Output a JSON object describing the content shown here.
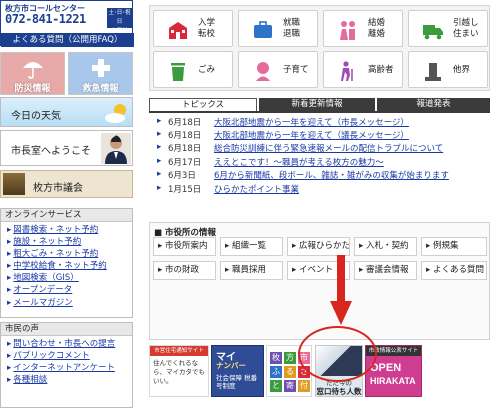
{
  "callcenter": {
    "label": "枚方市コールセンター",
    "number": "072-841-1221",
    "badge_line1": "土･日･祝日",
    "badge_line2": "も受付",
    "faq": "よくある質問（公開用FAQ）"
  },
  "left_tiles": {
    "bosai": "防災情報",
    "kyukyu": "救急情報",
    "weather": "今日の天気",
    "mayor": "市長室へようこそ",
    "council": "枚方市議会"
  },
  "online_services": {
    "heading": "オンラインサービス",
    "items": [
      "図書検索・ネット予約",
      "施設・ネット予約",
      "粗大ごみ・ネット予約",
      "中学校給食・ネット予約",
      "地図検索（GIS）",
      "オープンデータ",
      "メールマガジン"
    ]
  },
  "citizen_voice": {
    "heading": "市民の声",
    "items": [
      "問い合わせ・市長への提言",
      "パブリックコメント",
      "インターネットアンケート",
      "各種相談"
    ]
  },
  "categories": [
    {
      "label": "入学\n転校",
      "icon": "school-icon",
      "color": "#d8293a"
    },
    {
      "label": "就職\n退職",
      "icon": "briefcase-icon",
      "color": "#2f73c8"
    },
    {
      "label": "結婚\n離婚",
      "icon": "couple-icon",
      "color": "#e46b9b"
    },
    {
      "label": "引越し\n住まい",
      "icon": "truck-icon",
      "color": "#3c9b3c"
    },
    {
      "label": "ごみ",
      "icon": "trash-icon",
      "color": "#3c9b3c"
    },
    {
      "label": "子育て",
      "icon": "baby-icon",
      "color": "#e46b9b"
    },
    {
      "label": "高齢者",
      "icon": "elderly-icon",
      "color": "#a14bb7"
    },
    {
      "label": "他界",
      "icon": "grave-icon",
      "color": "#555555"
    }
  ],
  "topics": {
    "tabs": [
      "トピックス",
      "新着更新情報",
      "報道発表"
    ],
    "active_tab": 0,
    "items": [
      {
        "date": "6月18日",
        "title": "大阪北部地震から一年を迎えて（市長メッセージ）"
      },
      {
        "date": "6月18日",
        "title": "大阪北部地震から一年を迎えて（議長メッセージ）"
      },
      {
        "date": "6月18日",
        "title": "総合防災訓練に伴う緊急速報メールの配信トラブルについて"
      },
      {
        "date": "6月17日",
        "title": "ええとこです！〜職員が考える枚方の魅力〜"
      },
      {
        "date": "6月3日",
        "title": "6月から新聞紙、段ボール、雑誌・雑がみの収集が始まります"
      },
      {
        "date": "1月15日",
        "title": "ひらかたポイント事業"
      }
    ]
  },
  "office_info": {
    "heading": "市役所の情報",
    "buttons": [
      "市役所案内",
      "組織一覧",
      "広報ひらかた",
      "入札・契約",
      "例規集",
      "市の財政",
      "職員採用",
      "イベント",
      "審議会情報",
      "よくある質問"
    ]
  },
  "banners": {
    "b1_top": "市営住宅通知サイト",
    "b1_text": "住んでくれるなら、マイカタでもいい。",
    "b2_a": "マイ",
    "b2_b": "ナンバー",
    "b2_c": "社会保障 税番号制度",
    "b3_chars": [
      "枚",
      "方",
      "市",
      "ふ",
      "る",
      "さ",
      "と",
      "寄",
      "付"
    ],
    "b4_a": "ただ今の",
    "b4_b": "窓口待ち人数",
    "b5_top": "市政情報公表サイト",
    "b5_a": "OPEN",
    "b5_b": "HIRAKATA"
  },
  "colors": {
    "brand_blue": "#1d3f8f",
    "link_blue": "#1a3aa5",
    "tab_dark": "#3b3b3b",
    "highlight_red": "#d8261f"
  }
}
